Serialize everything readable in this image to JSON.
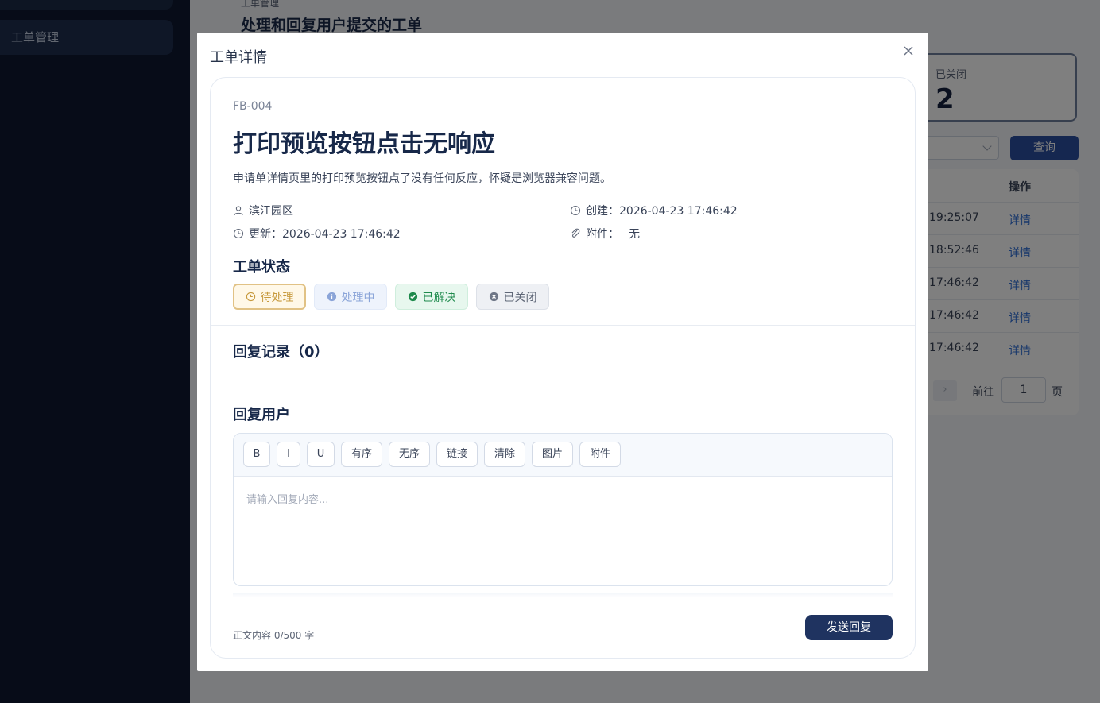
{
  "sidebar": {
    "active_item": "工单管理"
  },
  "header": {
    "breadcrumb": "工单管理",
    "title": "处理和回复用户提交的工单"
  },
  "stats": {
    "closed_label": "已关闭",
    "closed_value": "2"
  },
  "filters": {
    "query_button": "查询"
  },
  "table": {
    "op_header": "操作",
    "rows": [
      {
        "time": "19:25:07",
        "action": "详情"
      },
      {
        "time": "18:52:46",
        "action": "详情"
      },
      {
        "time": "17:46:42",
        "action": "详情"
      },
      {
        "time": "17:46:42",
        "action": "详情"
      },
      {
        "time": "17:46:42",
        "action": "详情"
      }
    ]
  },
  "pagination": {
    "next": "›",
    "goto_label": "前往",
    "page": "1",
    "unit": "页"
  },
  "modal": {
    "title": "工单详情",
    "ticket": {
      "id": "FB-004",
      "title": "打印预览按钮点击无响应",
      "description": "申请单详情页里的打印预览按钮点了没有任何反应，怀疑是浏览器兼容问题。",
      "location": "滨江园区",
      "created": "创建：2026-04-23 17:46:42",
      "updated": "更新：2026-04-23 17:46:42",
      "attachment_label": "附件：",
      "attachment_value": "无"
    },
    "status_section": {
      "title": "工单状态",
      "options": [
        "待处理",
        "处理中",
        "已解决",
        "已关闭"
      ],
      "selected": "待处理"
    },
    "replies": {
      "title": "回复记录（0）"
    },
    "reply_form": {
      "title": "回复用户",
      "toolbar": [
        "B",
        "I",
        "U",
        "有序",
        "无序",
        "链接",
        "清除",
        "图片",
        "附件"
      ],
      "placeholder": "请输入回复内容...",
      "char_count": "正文内容 0/500 字",
      "send_button": "发送回复"
    }
  },
  "colors": {
    "primary": "#1f3360",
    "accent": "#2a4ea0",
    "link": "#2f6fd6",
    "pending": "#c79a3e",
    "resolved": "#1e8a4c"
  }
}
